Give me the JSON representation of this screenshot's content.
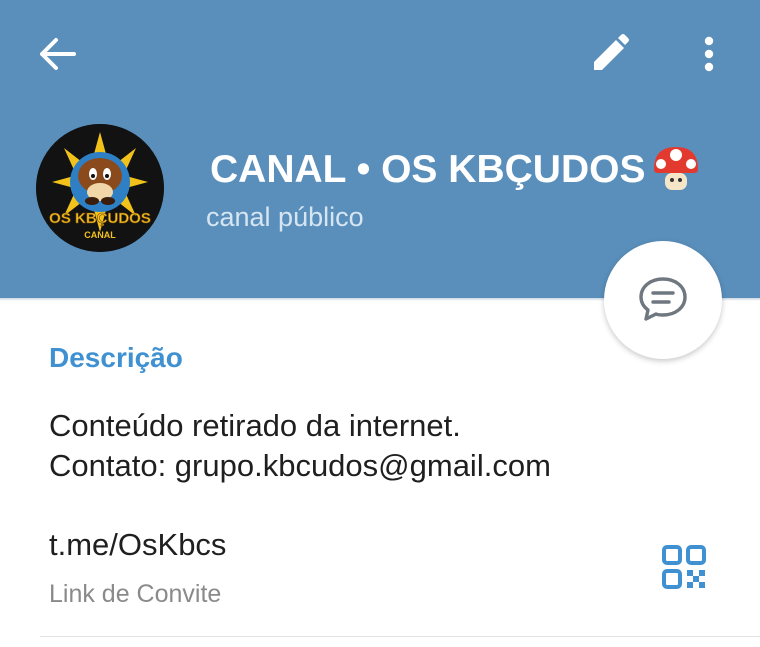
{
  "colors": {
    "header_bg": "#5a8fbb",
    "accent": "#3f91d1",
    "text_primary": "#1f1f1f",
    "text_secondary": "#8a8a8a"
  },
  "header": {
    "back_icon": "arrow-left-icon",
    "edit_icon": "pencil-icon",
    "more_icon": "more-vertical-icon",
    "avatar": {
      "logo_text": "OS KBÇUDOS",
      "logo_subtext": "CANAL"
    },
    "channel_name": "CANAL • OS KBÇUDOS",
    "channel_emoji": "mushroom-icon",
    "status": "canal público"
  },
  "fab": {
    "icon": "chat-bubble-icon"
  },
  "info": {
    "description_title": "Descrição",
    "description_lines": [
      "Conteúdo retirado da internet.",
      "Contato: grupo.kbcudos@gmail.com"
    ],
    "link": "t.me/OsKbcs",
    "link_label": "Link de Convite",
    "qr_icon": "qr-code-icon"
  }
}
